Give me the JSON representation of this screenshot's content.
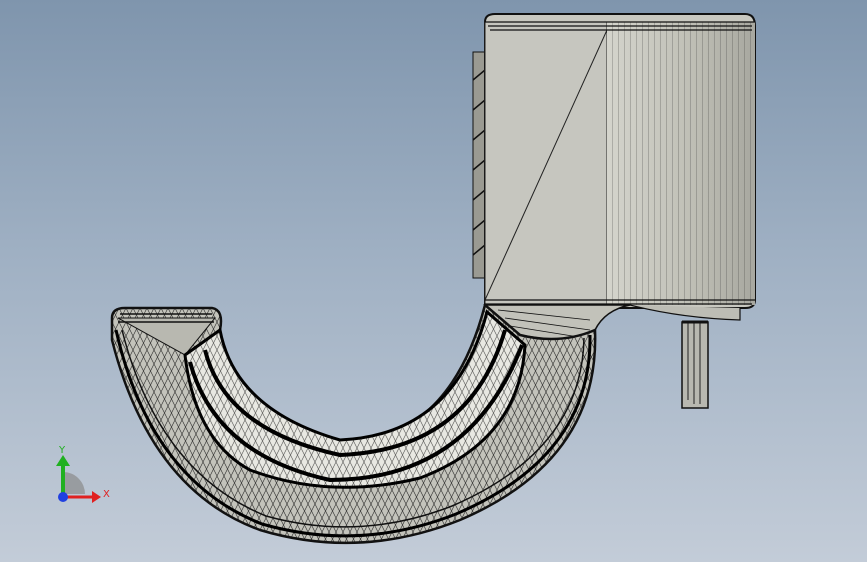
{
  "viewport": {
    "model": "mesh-hook-part",
    "colors": {
      "background_top": "#7f95ad",
      "background_bottom": "#c3ccd8",
      "body_face": "#c8c8c0",
      "body_shade": "#b9b9b0",
      "mesh_line": "#111111",
      "inner_face": "#e8e8e2"
    }
  },
  "triad": {
    "y_label": "Y",
    "x_label": "X",
    "colors": {
      "x": "#e02020",
      "y": "#20b020",
      "z": "#2040e0"
    }
  }
}
